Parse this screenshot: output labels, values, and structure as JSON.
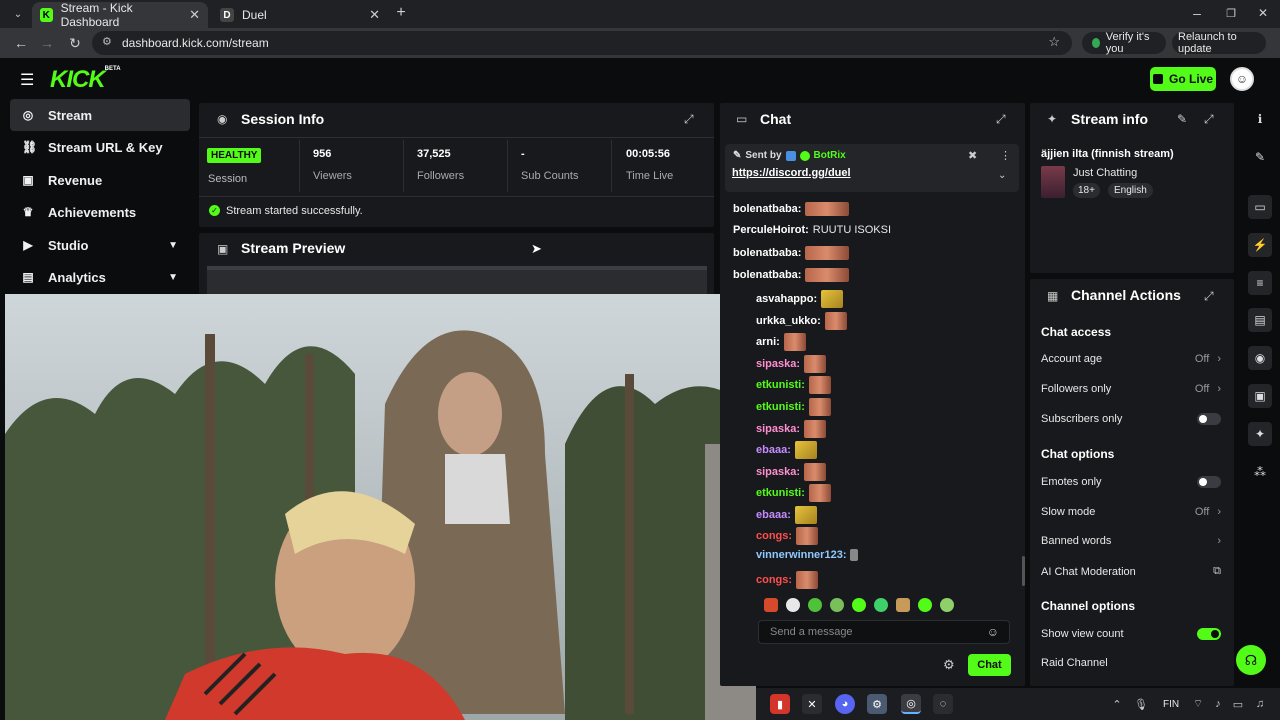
{
  "browser": {
    "tabs": [
      {
        "title": "Stream - Kick Dashboard",
        "favicon": "K"
      },
      {
        "title": "Duel",
        "favicon": "D"
      }
    ],
    "url": "dashboard.kick.com/stream",
    "verify_label": "Verify it's you",
    "relaunch_label": "Relaunch to update"
  },
  "header": {
    "logo": "KICK",
    "logo_tag": "BETA",
    "go_live": "Go Live"
  },
  "sidebar": {
    "items": [
      {
        "label": "Stream",
        "icon": "target-icon"
      },
      {
        "label": "Stream URL & Key",
        "icon": "link-icon"
      },
      {
        "label": "Revenue",
        "icon": "wallet-icon"
      },
      {
        "label": "Achievements",
        "icon": "trophy-icon"
      },
      {
        "label": "Studio",
        "icon": "play-icon"
      },
      {
        "label": "Analytics",
        "icon": "chart-icon"
      }
    ]
  },
  "session": {
    "title": "Session Info",
    "status": "HEALTHY",
    "status_label": "Session",
    "stats": [
      {
        "value": "956",
        "label": "Viewers"
      },
      {
        "value": "37,525",
        "label": "Followers"
      },
      {
        "value": "-",
        "label": "Sub Counts"
      },
      {
        "value": "00:05:56",
        "label": "Time Live"
      }
    ],
    "message": "Stream started successfully."
  },
  "preview": {
    "title": "Stream Preview"
  },
  "chat": {
    "title": "Chat",
    "pinned": {
      "sent_by": "Sent by",
      "author": "BotRix",
      "link": "https://discord.gg/duel"
    },
    "messages": [
      {
        "user": "bolenatbaba:",
        "color": "#ffffff",
        "text": "",
        "emote": "wide"
      },
      {
        "user": "PerculeHoirot:",
        "color": "#ffffff",
        "text": "RUUTU ISOKSI",
        "emote": ""
      },
      {
        "user": "bolenatbaba:",
        "color": "#ffffff",
        "text": "",
        "emote": "wide"
      },
      {
        "user": "bolenatbaba:",
        "color": "#ffffff",
        "text": "",
        "emote": "wide"
      },
      {
        "user": "asvahappo:",
        "color": "#ffffff",
        "text": "",
        "emote": "gold"
      },
      {
        "user": "urkka_ukko:",
        "color": "#ffffff",
        "text": "",
        "emote": "sq"
      },
      {
        "user": "arni:",
        "color": "#ffffff",
        "text": "",
        "emote": "sq"
      },
      {
        "user": "sipaska:",
        "color": "#ff8fd1",
        "text": "",
        "emote": "sq"
      },
      {
        "user": "etkunisti:",
        "color": "#53fc18",
        "text": "",
        "emote": "sq"
      },
      {
        "user": "etkunisti:",
        "color": "#53fc18",
        "text": "",
        "emote": "sq"
      },
      {
        "user": "sipaska:",
        "color": "#ff8fd1",
        "text": "",
        "emote": "sq"
      },
      {
        "user": "ebaaa:",
        "color": "#c38cff",
        "text": "",
        "emote": "gold"
      },
      {
        "user": "sipaska:",
        "color": "#ff8fd1",
        "text": "",
        "emote": "sq"
      },
      {
        "user": "etkunisti:",
        "color": "#53fc18",
        "text": "",
        "emote": "sq"
      },
      {
        "user": "ebaaa:",
        "color": "#c38cff",
        "text": "",
        "emote": "gold"
      },
      {
        "user": "congs:",
        "color": "#ff4e4e",
        "text": "",
        "emote": "sq"
      },
      {
        "user": "vinnerwinner123:",
        "color": "#8fc9ff",
        "text": "",
        "emote": "tiny"
      },
      {
        "user": "congs:",
        "color": "#ff4e4e",
        "text": "",
        "emote": "sq"
      }
    ],
    "input_placeholder": "Send a message",
    "send_label": "Chat"
  },
  "stream_info": {
    "title": "Stream info",
    "stream_title": "äjjien ilta (finnish stream)",
    "category": "Just Chatting",
    "tags": [
      "18+",
      "English"
    ]
  },
  "channel_actions": {
    "title": "Channel Actions",
    "sections": {
      "chat_access": "Chat access",
      "chat_options": "Chat options",
      "channel_options": "Channel options"
    },
    "account_age": {
      "label": "Account age",
      "value": "Off"
    },
    "followers_only": {
      "label": "Followers only",
      "value": "Off"
    },
    "subscribers_only": {
      "label": "Subscribers only",
      "on": false
    },
    "emotes_only": {
      "label": "Emotes only",
      "on": false
    },
    "slow_mode": {
      "label": "Slow mode",
      "value": "Off"
    },
    "banned_words": {
      "label": "Banned words"
    },
    "ai_moderation": {
      "label": "AI Chat Moderation"
    },
    "show_view_count": {
      "label": "Show view count",
      "on": true
    },
    "raid_channel": {
      "label": "Raid Channel"
    }
  },
  "taskbar": {
    "lang": "FIN"
  },
  "colors": {
    "accent": "#53fc18",
    "panel": "#18191c",
    "background": "#0b0c0e"
  }
}
